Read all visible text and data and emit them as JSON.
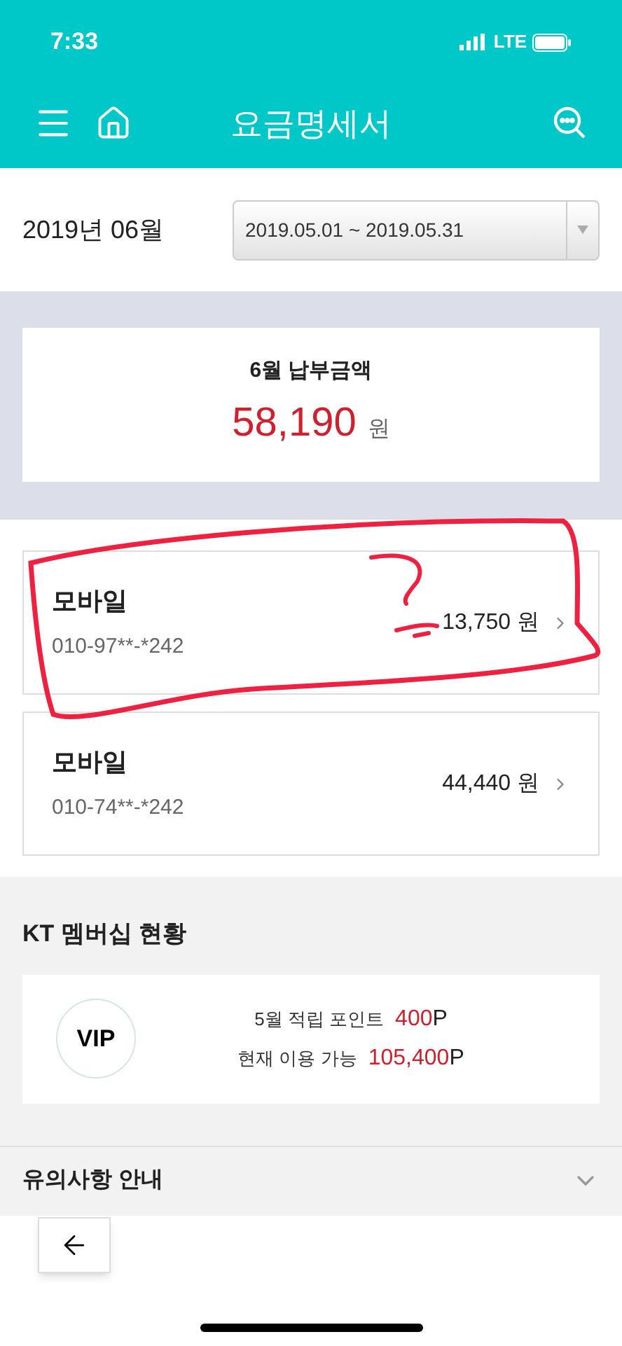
{
  "status_bar": {
    "time": "7:33",
    "network": "LTE"
  },
  "header": {
    "title": "요금명세서"
  },
  "period": {
    "month": "2019년 06월",
    "range": "2019.05.01 ~ 2019.05.31"
  },
  "total": {
    "label": "6월 납부금액",
    "amount": "58,190",
    "unit": "원"
  },
  "lines": [
    {
      "name": "모바일",
      "number": "010-97**-*242",
      "amount": "13,750 원"
    },
    {
      "name": "모바일",
      "number": "010-74**-*242",
      "amount": "44,440 원"
    }
  ],
  "membership": {
    "title": "KT 멤버십 현황",
    "grade": "VIP",
    "rows": [
      {
        "label": "5월 적립 포인트",
        "value": "400",
        "unit": "P"
      },
      {
        "label": "현재 이용 가능",
        "value": "105,400",
        "unit": "P"
      }
    ]
  },
  "notice": {
    "title": "유의사항 안내",
    "expanded": false
  }
}
